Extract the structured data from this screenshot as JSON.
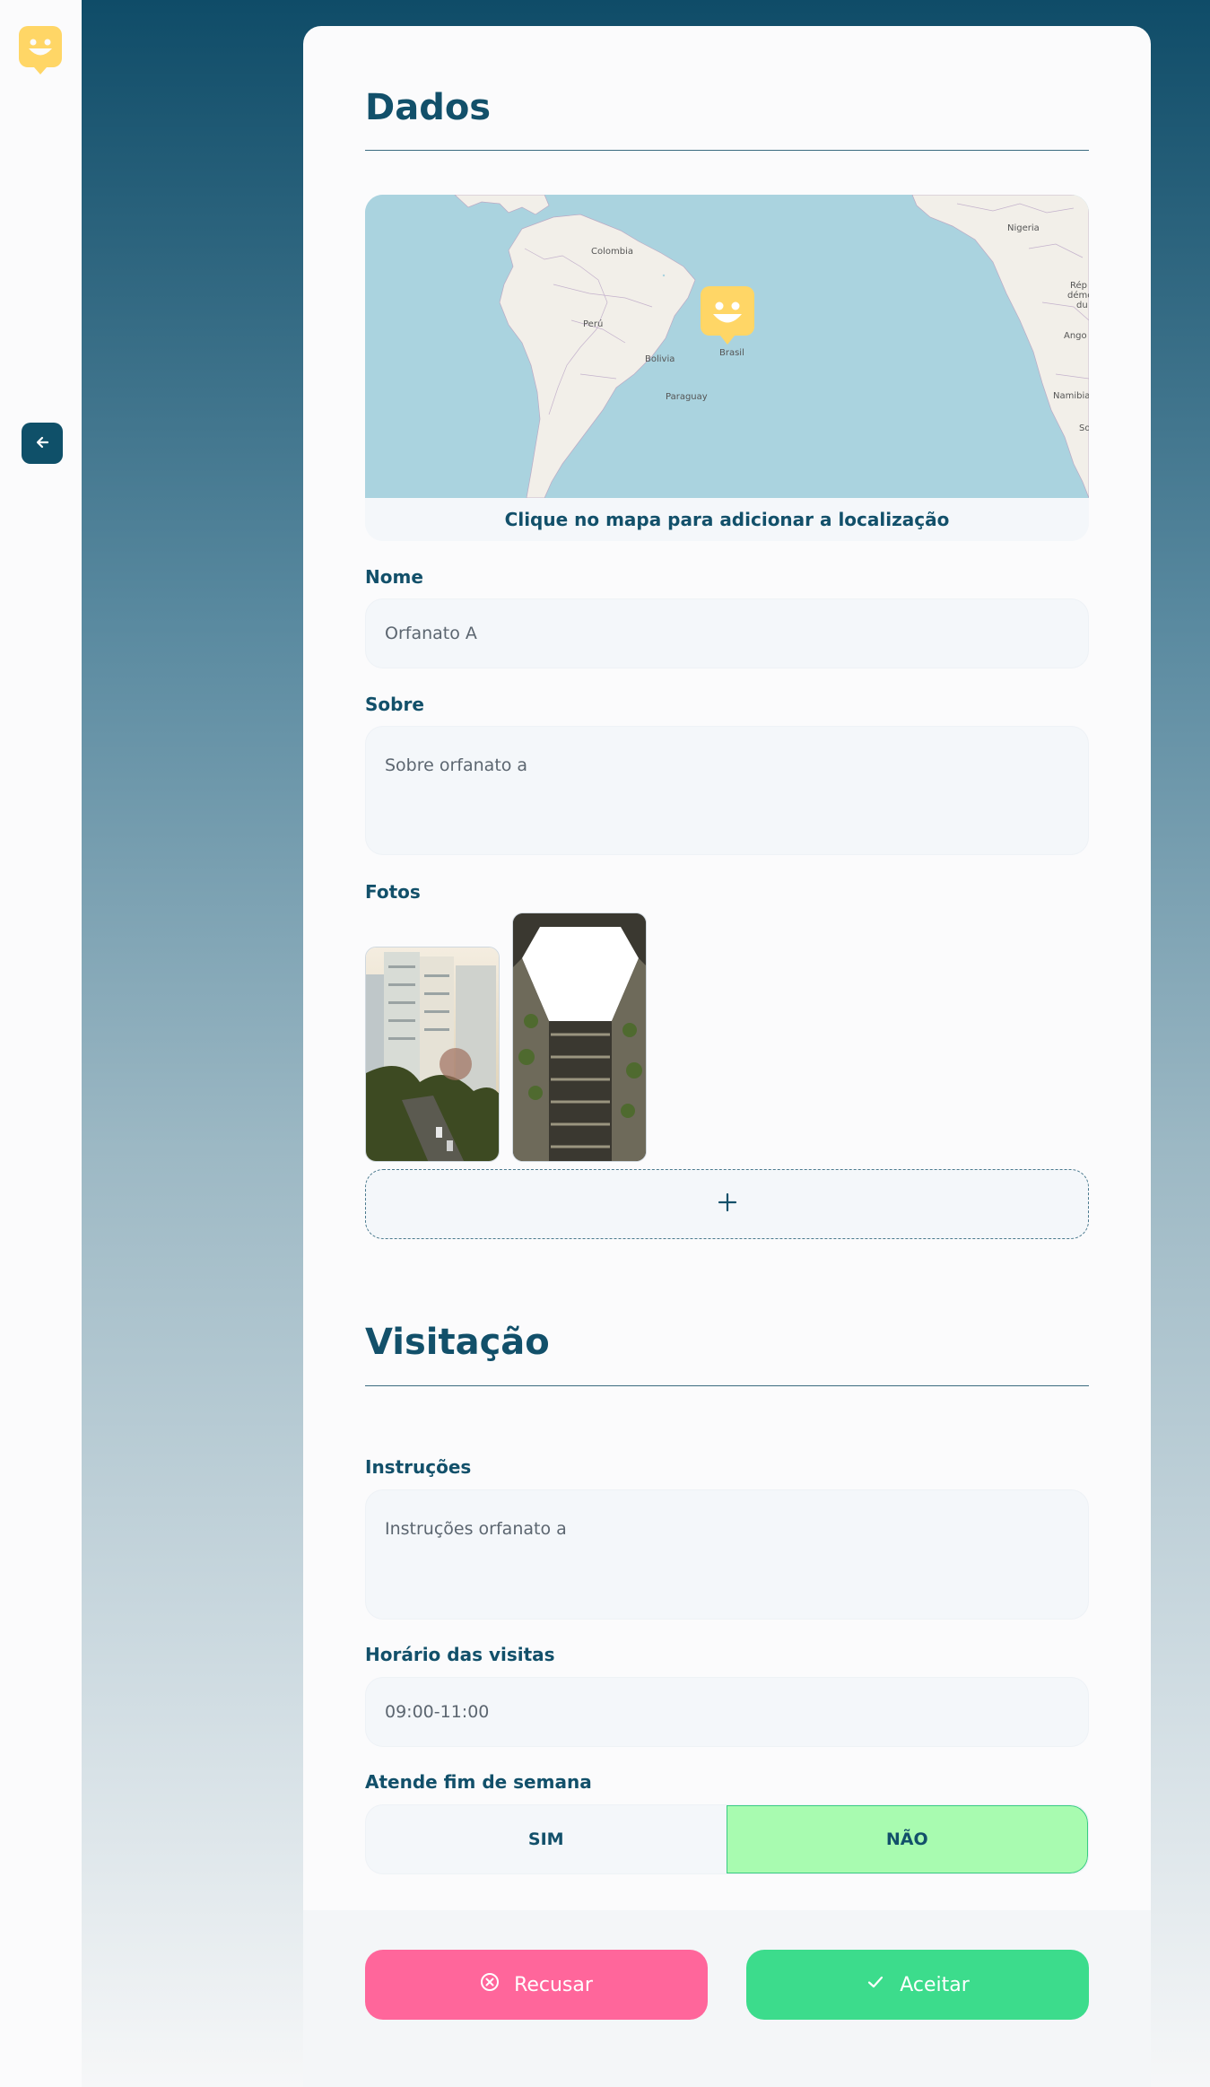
{
  "sidebar": {
    "logo_icon": "happy-marker-icon",
    "back_icon": "arrow-left-icon"
  },
  "sections": {
    "dados_title": "Dados",
    "visitacao_title": "Visitação"
  },
  "map": {
    "caption": "Clique no mapa para adicionar a localização",
    "labels": {
      "colombia": "Colombia",
      "peru": "Perú",
      "bolivia": "Bolivia",
      "brasil": "Brasil",
      "paraguay": "Paraguay",
      "nigeria": "Nigeria",
      "angola": "Ango",
      "namibia": "Namibia",
      "rep": "Rép",
      "dem": "démo",
      "du": "du",
      "south": "So"
    }
  },
  "form": {
    "nome_label": "Nome",
    "nome_value": "Orfanato A",
    "sobre_label": "Sobre",
    "sobre_value": "Sobre orfanato a",
    "fotos_label": "Fotos",
    "add_photo_icon": "plus-icon",
    "instrucoes_label": "Instruções",
    "instrucoes_value": "Instruções orfanato a",
    "horario_label": "Horário das visitas",
    "horario_value": "09:00-11:00",
    "fim_semana_label": "Atende fim de semana",
    "sim_label": "SIM",
    "nao_label": "NÃO",
    "fim_semana_selected": "NÃO"
  },
  "actions": {
    "reject_label": "Recusar",
    "reject_icon": "x-circle-icon",
    "accept_label": "Aceitar",
    "accept_icon": "check-icon"
  },
  "colors": {
    "primary": "#12506a",
    "reject": "#ff669b",
    "accept": "#3cdc8c",
    "selected_toggle": "#a8fbb0",
    "marker": "#ffd666"
  }
}
